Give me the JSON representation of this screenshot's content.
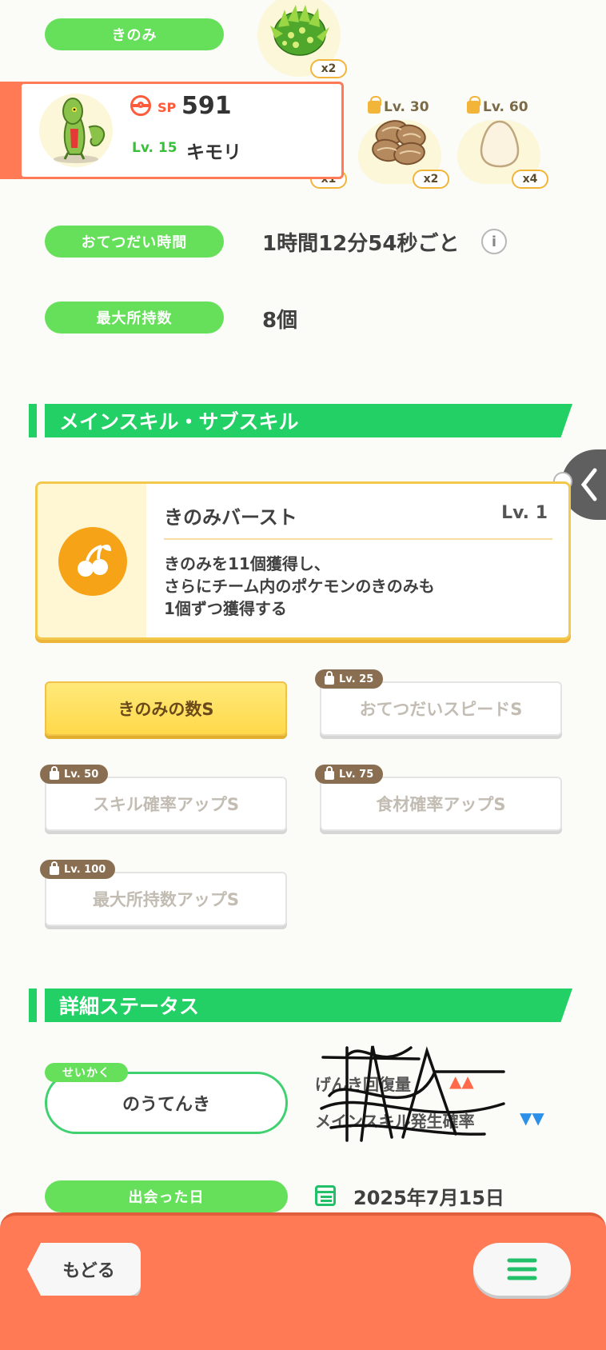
{
  "berry": {
    "label": "きのみ",
    "count": "x2"
  },
  "pokemon_card": {
    "sp_label": "SP",
    "sp_value": "591",
    "level": "Lv. 15",
    "name": "キモリ",
    "hidden_badge": "x1"
  },
  "ingredients": [
    {
      "unlock": "Lv. 30",
      "count": "x2"
    },
    {
      "unlock": "Lv. 60",
      "count": "x4"
    }
  ],
  "help_time": {
    "label": "おてつだい時間",
    "value": "1時間12分54秒ごと"
  },
  "max_carry": {
    "label": "最大所持数",
    "value": "8個"
  },
  "skills_section": {
    "title": "メインスキル・サブスキル"
  },
  "main_skill": {
    "name": "きのみバースト",
    "level": "Lv. 1",
    "desc_lines": [
      "きのみを11個獲得し、",
      "さらにチーム内のポケモンのきのみも",
      "1個ずつ獲得する"
    ]
  },
  "sub_skills": [
    {
      "label": "きのみの数S",
      "unlock": "",
      "active": true
    },
    {
      "label": "おてつだいスピードS",
      "unlock": "Lv. 25",
      "active": false
    },
    {
      "label": "スキル確率アップS",
      "unlock": "Lv. 50",
      "active": false
    },
    {
      "label": "食材確率アップS",
      "unlock": "Lv. 75",
      "active": false
    },
    {
      "label": "最大所持数アップS",
      "unlock": "Lv. 100",
      "active": false
    }
  ],
  "details_section": {
    "title": "詳細ステータス"
  },
  "nature": {
    "tag": "せいかく",
    "value": "のうてんき",
    "up_stat": "げんき回復量",
    "down_stat": "メインスキル発生確率",
    "up_marker": "▲▲",
    "down_marker": "▼▼"
  },
  "met_date": {
    "label": "出会った日",
    "value": "2025年7月15日"
  },
  "footer": {
    "back_label": "もどる"
  },
  "colors": {
    "accent_green": "#66E05A",
    "section_green": "#22D065",
    "footer_orange": "#FF7A55",
    "skill_orange": "#F6A318"
  }
}
